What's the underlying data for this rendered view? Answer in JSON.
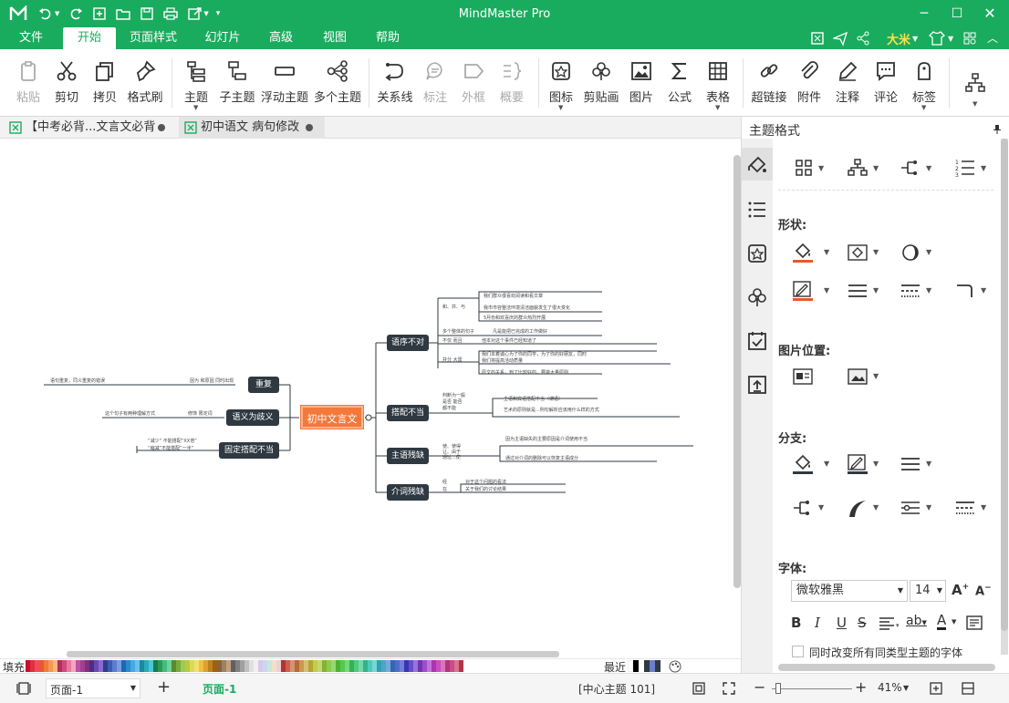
{
  "app": {
    "title": "MindMaster Pro"
  },
  "menu": {
    "items": [
      "文件",
      "开始",
      "页面样式",
      "幻灯片",
      "高级",
      "视图",
      "帮助"
    ],
    "active": "开始",
    "user": "大米"
  },
  "ribbon": {
    "buttons": [
      {
        "label": "粘贴",
        "icon": "paste-icon",
        "disabled": true
      },
      {
        "label": "剪切",
        "icon": "cut-icon"
      },
      {
        "label": "拷贝",
        "icon": "copy-icon"
      },
      {
        "label": "格式刷",
        "icon": "format-brush-icon"
      },
      {
        "label": "主题",
        "icon": "topic-icon"
      },
      {
        "label": "子主题",
        "icon": "subtopic-icon"
      },
      {
        "label": "浮动主题",
        "icon": "floating-topic-icon"
      },
      {
        "label": "多个主题",
        "icon": "multiple-topics-icon"
      },
      {
        "label": "关系线",
        "icon": "relationship-icon"
      },
      {
        "label": "标注",
        "icon": "callout-icon",
        "disabled": true
      },
      {
        "label": "外框",
        "icon": "boundary-icon",
        "disabled": true
      },
      {
        "label": "概要",
        "icon": "summary-icon",
        "disabled": true
      },
      {
        "label": "图标",
        "icon": "icon-icon"
      },
      {
        "label": "剪贴画",
        "icon": "clipart-icon"
      },
      {
        "label": "图片",
        "icon": "picture-icon"
      },
      {
        "label": "公式",
        "icon": "formula-icon"
      },
      {
        "label": "表格",
        "icon": "table-icon"
      },
      {
        "label": "超链接",
        "icon": "hyperlink-icon"
      },
      {
        "label": "附件",
        "icon": "attachment-icon"
      },
      {
        "label": "注释",
        "icon": "note-icon"
      },
      {
        "label": "评论",
        "icon": "comment-icon"
      },
      {
        "label": "标签",
        "icon": "tag-icon"
      }
    ]
  },
  "tabs": [
    {
      "label": "【中考必背...文言文必背",
      "active": false
    },
    {
      "label": "初中语文 病句修改",
      "active": true
    }
  ],
  "mindmap": {
    "center": "初中文言文",
    "right": [
      {
        "label": "语序不对",
        "leaves": [
          "和、并、与",
          "我们群众很喜欢阅读和看文章",
          "我市市容整洁环境清洁面貌发生了很大变化",
          "5月份和欢喜庆的群众热烈开展",
          "多个整体的句子",
          "凡是能把已完成的工作做好",
          "不仅 而且",
          "他本对这个事件已经知道了",
          "并分 大雷",
          "我们本着诚心为了你的同学，为了你的好朋友，同时",
          "我们将提高活动质量",
          "原文的关系，到了比较好的，要将大量原则"
        ]
      },
      {
        "label": "搭配不当",
        "leaves": [
          "判断为一般",
          "是否 能否",
          "都不能",
          "主语和宾语搭配不当（谓语）",
          "艺术的原则就是...例句解析应该用什么样的方式"
        ]
      },
      {
        "label": "主语残缺",
        "leaves": [
          "使、使得",
          "让、由于",
          "通过...使",
          "因为主语缺失的主要原因是介词使用不当",
          "通过对介词的删除可以恢复主语成分"
        ]
      },
      {
        "label": "介词残缺",
        "leaves": [
          "经",
          "在",
          "对于这个问题的看法",
          "关于我们的讨论结果"
        ]
      }
    ],
    "left": [
      {
        "label": "重复",
        "leaves": [
          "语句重复，同义重复的错误",
          "因为 和原因 同时出现"
        ]
      },
      {
        "label": "语义为歧义",
        "leaves": [
          "这个句子有两种理解方式",
          "修饰 限定词"
        ]
      },
      {
        "label": "固定搭配不当",
        "leaves": [
          "“减少” 不能搭配“XX倍”",
          "“缩减”不能搭配“一半”"
        ]
      }
    ]
  },
  "palette": {
    "label": "填充",
    "recent": "最近"
  },
  "status": {
    "page_select": "页面-1",
    "page_tab": "页面-1",
    "center_info": "[中心主题 101]",
    "zoom": "41%"
  },
  "panel": {
    "title": "主题格式",
    "sections": {
      "shape": "形状:",
      "image_pos": "图片位置:",
      "branch": "分支:",
      "font": "字体:"
    },
    "font": {
      "family": "微软雅黑",
      "size": "14"
    },
    "same_type_label": "同时改变所有同类型主题的字体"
  },
  "colors": {
    "brand": "#1aac5e",
    "center_node": "#f3793a",
    "sub_node": "#2f3941",
    "accent_red": "#e8592a"
  }
}
